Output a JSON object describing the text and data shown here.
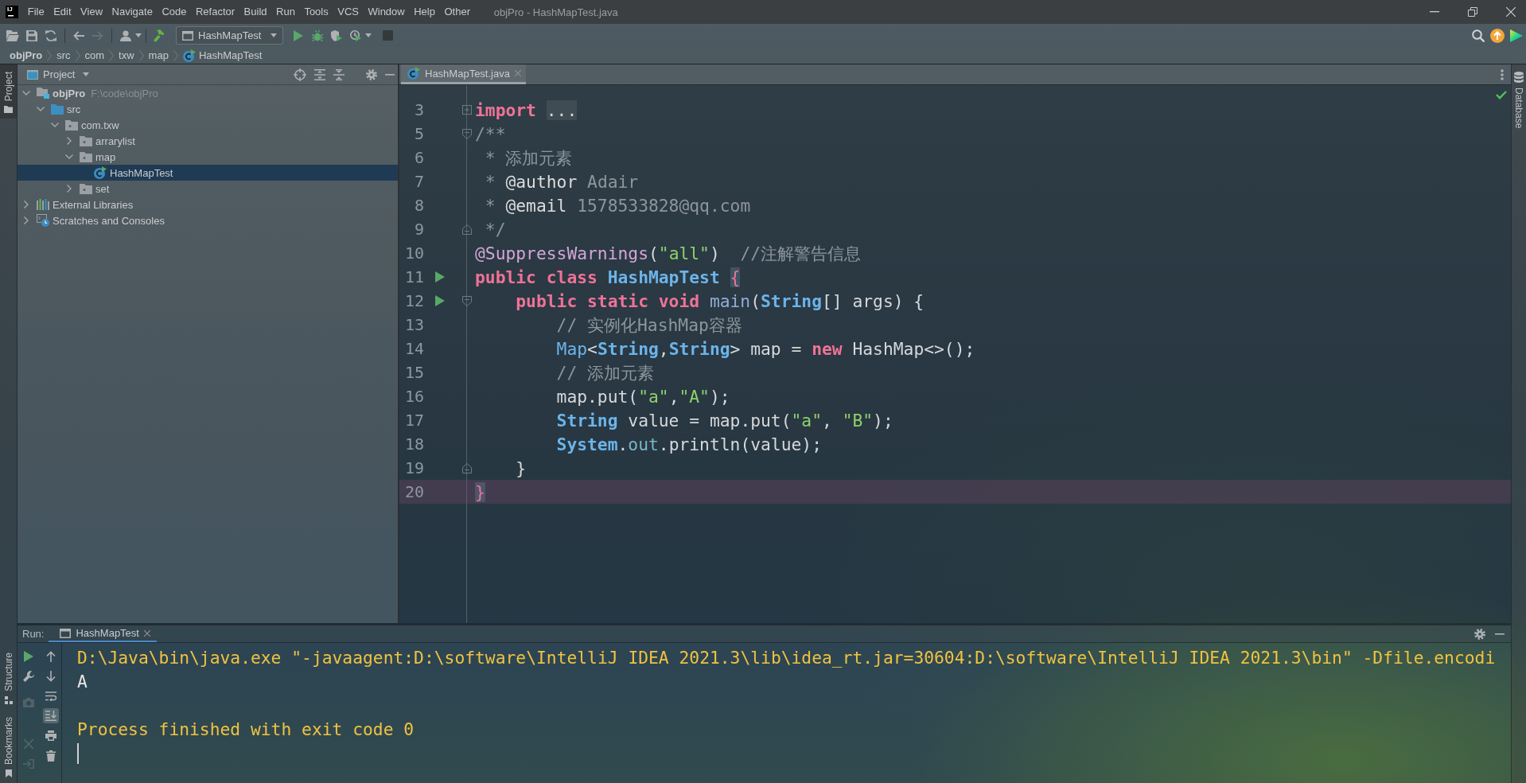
{
  "title_bar": {
    "logo": "IJ",
    "menu": [
      "File",
      "Edit",
      "View",
      "Navigate",
      "Code",
      "Refactor",
      "Build",
      "Run",
      "Tools",
      "VCS",
      "Window",
      "Help",
      "Other"
    ],
    "title": "objPro - HashMapTest.java"
  },
  "toolbar": {
    "groups": [
      [
        {
          "kind": "open",
          "disabled": false
        },
        {
          "kind": "save",
          "disabled": false
        },
        {
          "kind": "sync",
          "disabled": false
        }
      ],
      [
        {
          "kind": "back",
          "disabled": false
        },
        {
          "kind": "forward",
          "disabled": true
        }
      ],
      [
        {
          "kind": "user",
          "disabled": false
        }
      ],
      [
        {
          "kind": "build",
          "disabled": false
        }
      ]
    ],
    "run_configuration": "HashMapTest",
    "run_buttons": [
      {
        "kind": "run",
        "disabled": false
      },
      {
        "kind": "debug",
        "disabled": false
      },
      {
        "kind": "coverage",
        "disabled": false
      },
      {
        "kind": "profile",
        "disabled": false
      },
      {
        "kind": "stop",
        "disabled": true
      }
    ],
    "right_buttons": [
      {
        "kind": "search",
        "disabled": false
      },
      {
        "kind": "update",
        "disabled": false
      },
      {
        "kind": "toolbox",
        "disabled": false
      }
    ]
  },
  "breadcrumbs": [
    {
      "label": "objPro",
      "kind": "project"
    },
    {
      "label": "src",
      "kind": "folder"
    },
    {
      "label": "com",
      "kind": "folder"
    },
    {
      "label": "txw",
      "kind": "folder"
    },
    {
      "label": "map",
      "kind": "folder"
    },
    {
      "label": "HashMapTest",
      "kind": "class"
    }
  ],
  "left_strip": {
    "top": [
      {
        "label": "Project",
        "kind": "project",
        "selected": true
      }
    ],
    "bottom": [
      {
        "label": "Structure",
        "kind": "structure",
        "selected": false
      },
      {
        "label": "Bookmarks",
        "kind": "bookmarks",
        "selected": false
      }
    ]
  },
  "project_panel": {
    "title": "Project",
    "tree": [
      {
        "label": "objPro",
        "path": "F:\\code\\objPro",
        "kind": "module",
        "expanded": true,
        "selected": false,
        "children": [
          {
            "label": "src",
            "kind": "source-folder",
            "expanded": true,
            "selected": false,
            "children": [
              {
                "label": "com.txw",
                "kind": "package",
                "expanded": true,
                "selected": false,
                "children": [
                  {
                    "label": "arrarylist",
                    "kind": "package",
                    "expanded": false,
                    "selected": false
                  },
                  {
                    "label": "map",
                    "kind": "package",
                    "expanded": true,
                    "selected": false,
                    "children": [
                      {
                        "label": "HashMapTest",
                        "kind": "class",
                        "selected": true
                      }
                    ]
                  },
                  {
                    "label": "set",
                    "kind": "package",
                    "expanded": false,
                    "selected": false
                  }
                ]
              }
            ]
          }
        ]
      },
      {
        "label": "External Libraries",
        "kind": "libraries",
        "expanded": false,
        "selected": false
      },
      {
        "label": "Scratches and Consoles",
        "kind": "scratches",
        "expanded": false,
        "selected": false
      }
    ]
  },
  "editor": {
    "tabs": [
      {
        "label": "HashMapTest.java",
        "selected": true
      }
    ],
    "inspection_passed": true,
    "lines": [
      {
        "number": "3",
        "current": false,
        "run_icon": false,
        "fold_marker": {
          "kind": "collapsed"
        },
        "tokens": [
          {
            "text": "import ",
            "kind": "keyword"
          },
          {
            "text": "...",
            "kind": "folded"
          }
        ]
      },
      {
        "number": "5",
        "current": false,
        "run_icon": false,
        "fold_marker": {
          "kind": "start"
        },
        "tokens": [
          {
            "text": "/**",
            "kind": "comment"
          }
        ]
      },
      {
        "number": "6",
        "current": false,
        "run_icon": false,
        "tokens": [
          {
            "text": " * 添加元素",
            "kind": "comment"
          }
        ]
      },
      {
        "number": "7",
        "current": false,
        "run_icon": false,
        "tokens": [
          {
            "text": " * ",
            "kind": "comment"
          },
          {
            "text": "@author",
            "kind": "doc-tag"
          },
          {
            "text": " Adair",
            "kind": "comment"
          }
        ]
      },
      {
        "number": "8",
        "current": false,
        "run_icon": false,
        "tokens": [
          {
            "text": " * ",
            "kind": "comment"
          },
          {
            "text": "@email",
            "kind": "doc-tag"
          },
          {
            "text": " 1578533828@qq.com",
            "kind": "comment"
          }
        ]
      },
      {
        "number": "9",
        "current": false,
        "run_icon": false,
        "fold_marker": {
          "kind": "end"
        },
        "tokens": [
          {
            "text": " */",
            "kind": "comment"
          }
        ]
      },
      {
        "number": "10",
        "current": false,
        "run_icon": false,
        "tokens": [
          {
            "text": "@SuppressWarnings",
            "kind": "annotation"
          },
          {
            "text": "(",
            "kind": "plain"
          },
          {
            "text": "\"all\"",
            "kind": "string"
          },
          {
            "text": ")  ",
            "kind": "plain"
          },
          {
            "text": "//注解警告信息",
            "kind": "comment"
          }
        ]
      },
      {
        "number": "11",
        "current": false,
        "run_icon": true,
        "tokens": [
          {
            "text": "public class ",
            "kind": "keyword"
          },
          {
            "text": "HashMapTest ",
            "kind": "type"
          },
          {
            "text": "{",
            "kind": "brace"
          }
        ]
      },
      {
        "number": "12",
        "current": false,
        "run_icon": true,
        "fold_marker": {
          "kind": "start"
        },
        "tokens": [
          {
            "text": "    public static void ",
            "kind": "keyword"
          },
          {
            "text": "main",
            "kind": "method"
          },
          {
            "text": "(",
            "kind": "plain"
          },
          {
            "text": "String",
            "kind": "type"
          },
          {
            "text": "[] args) {",
            "kind": "plain"
          }
        ]
      },
      {
        "number": "13",
        "current": false,
        "run_icon": false,
        "tokens": [
          {
            "text": "        // 实例化HashMap容器",
            "kind": "comment"
          }
        ]
      },
      {
        "number": "14",
        "current": false,
        "run_icon": false,
        "tokens": [
          {
            "text": "        Map",
            "kind": "type-plain"
          },
          {
            "text": "<",
            "kind": "plain"
          },
          {
            "text": "String",
            "kind": "type"
          },
          {
            "text": ",",
            "kind": "plain"
          },
          {
            "text": "String",
            "kind": "type"
          },
          {
            "text": "> map = ",
            "kind": "plain"
          },
          {
            "text": "new",
            "kind": "keyword"
          },
          {
            "text": " HashMap<>();",
            "kind": "plain"
          }
        ]
      },
      {
        "number": "15",
        "current": false,
        "run_icon": false,
        "tokens": [
          {
            "text": "        // 添加元素",
            "kind": "comment"
          }
        ]
      },
      {
        "number": "16",
        "current": false,
        "run_icon": false,
        "tokens": [
          {
            "text": "        map.put(",
            "kind": "plain"
          },
          {
            "text": "\"a\"",
            "kind": "string"
          },
          {
            "text": ",",
            "kind": "plain"
          },
          {
            "text": "\"A\"",
            "kind": "string"
          },
          {
            "text": ");",
            "kind": "plain"
          }
        ]
      },
      {
        "number": "17",
        "current": false,
        "run_icon": false,
        "tokens": [
          {
            "text": "        String",
            "kind": "type"
          },
          {
            "text": " value = map.put(",
            "kind": "plain"
          },
          {
            "text": "\"a\"",
            "kind": "string"
          },
          {
            "text": ", ",
            "kind": "plain"
          },
          {
            "text": "\"B\"",
            "kind": "string"
          },
          {
            "text": ");",
            "kind": "plain"
          }
        ]
      },
      {
        "number": "18",
        "current": false,
        "run_icon": false,
        "tokens": [
          {
            "text": "        System",
            "kind": "type"
          },
          {
            "text": ".",
            "kind": "plain"
          },
          {
            "text": "out",
            "kind": "field"
          },
          {
            "text": ".println(value);",
            "kind": "plain"
          }
        ]
      },
      {
        "number": "19",
        "current": false,
        "run_icon": false,
        "fold_marker": {
          "kind": "end"
        },
        "tokens": [
          {
            "text": "    }",
            "kind": "plain"
          }
        ]
      },
      {
        "number": "20",
        "current": true,
        "run_icon": false,
        "tokens": [
          {
            "text": "}",
            "kind": "brace"
          }
        ]
      }
    ]
  },
  "run_panel": {
    "label": "Run:",
    "tabs": [
      {
        "label": "HashMapTest",
        "selected": true
      }
    ],
    "toolbar": [
      {
        "kind": "rerun",
        "disabled": false
      },
      {
        "kind": "wrench",
        "disabled": false
      },
      {
        "kind": "camera",
        "disabled": true
      },
      {
        "kind": "close",
        "disabled": true
      },
      {
        "kind": "exit",
        "disabled": true
      }
    ],
    "actions": [
      {
        "kind": "up"
      },
      {
        "kind": "down"
      },
      {
        "kind": "soft-wrap",
        "selected": false
      },
      {
        "kind": "scroll-end",
        "selected": true
      },
      {
        "kind": "print"
      },
      {
        "kind": "clear"
      }
    ],
    "console": {
      "lines": [
        {
          "kind": "command",
          "text": "D:\\Java\\bin\\java.exe \"-javaagent:D:\\software\\IntelliJ IDEA 2021.3\\lib\\idea_rt.jar=30604:D:\\software\\IntelliJ IDEA 2021.3\\bin\" -Dfile.encodi"
        },
        {
          "kind": "output",
          "text": "A"
        },
        {
          "kind": "blank"
        },
        {
          "kind": "system",
          "text": "Process finished with exit code 0"
        }
      ],
      "caret": true
    }
  },
  "right_strip": [
    {
      "label": "Database",
      "kind": "database",
      "selected": false
    }
  ]
}
